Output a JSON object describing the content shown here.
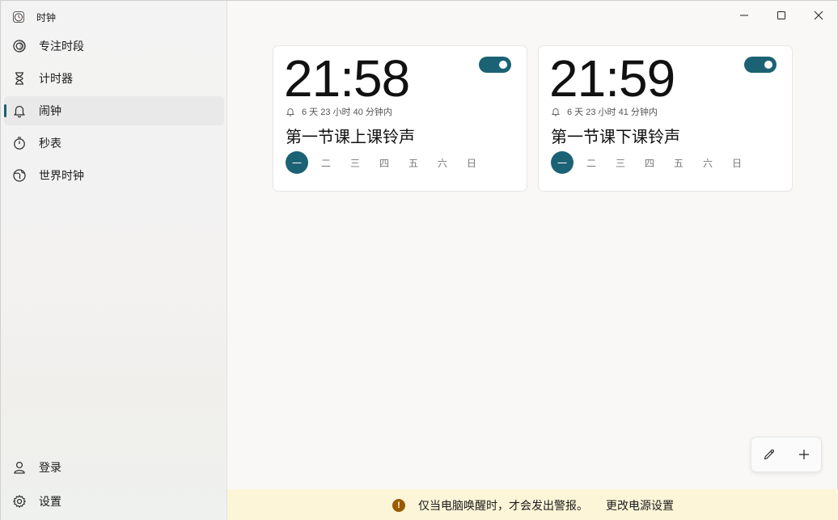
{
  "app": {
    "title": "时钟",
    "icon": "clock-app-icon"
  },
  "sidebar": {
    "items": [
      {
        "label": "专注时段",
        "icon": "focus-icon",
        "active": false
      },
      {
        "label": "计时器",
        "icon": "hourglass-icon",
        "active": false
      },
      {
        "label": "闹钟",
        "icon": "bell-icon",
        "active": true
      },
      {
        "label": "秒表",
        "icon": "stopwatch-icon",
        "active": false
      },
      {
        "label": "世界时钟",
        "icon": "globe-icon",
        "active": false
      }
    ],
    "bottom": [
      {
        "label": "登录",
        "icon": "person-icon"
      },
      {
        "label": "设置",
        "icon": "gear-icon"
      }
    ]
  },
  "window_controls": [
    "minimize",
    "maximize",
    "close"
  ],
  "alarms": [
    {
      "time": "21:58",
      "enabled": true,
      "remaining": "6 天 23 小时 40 分钟内",
      "name": "第一节课上课铃声",
      "days": [
        "一",
        "二",
        "三",
        "四",
        "五",
        "六",
        "日"
      ],
      "active_days": [
        true,
        false,
        false,
        false,
        false,
        false,
        false
      ]
    },
    {
      "time": "21:59",
      "enabled": true,
      "remaining": "6 天 23 小时 41 分钟内",
      "name": "第一节课下课铃声",
      "days": [
        "一",
        "二",
        "三",
        "四",
        "五",
        "六",
        "日"
      ],
      "active_days": [
        true,
        false,
        false,
        false,
        false,
        false,
        false
      ]
    }
  ],
  "fab": {
    "edit_icon": "pencil-icon",
    "add_icon": "plus-icon"
  },
  "banner": {
    "message": "仅当电脑唤醒时，才会发出警报。",
    "link": "更改电源设置"
  },
  "colors": {
    "accent": "#1c6275",
    "banner_bg": "#fdf5d8",
    "warning": "#9b5a00"
  }
}
